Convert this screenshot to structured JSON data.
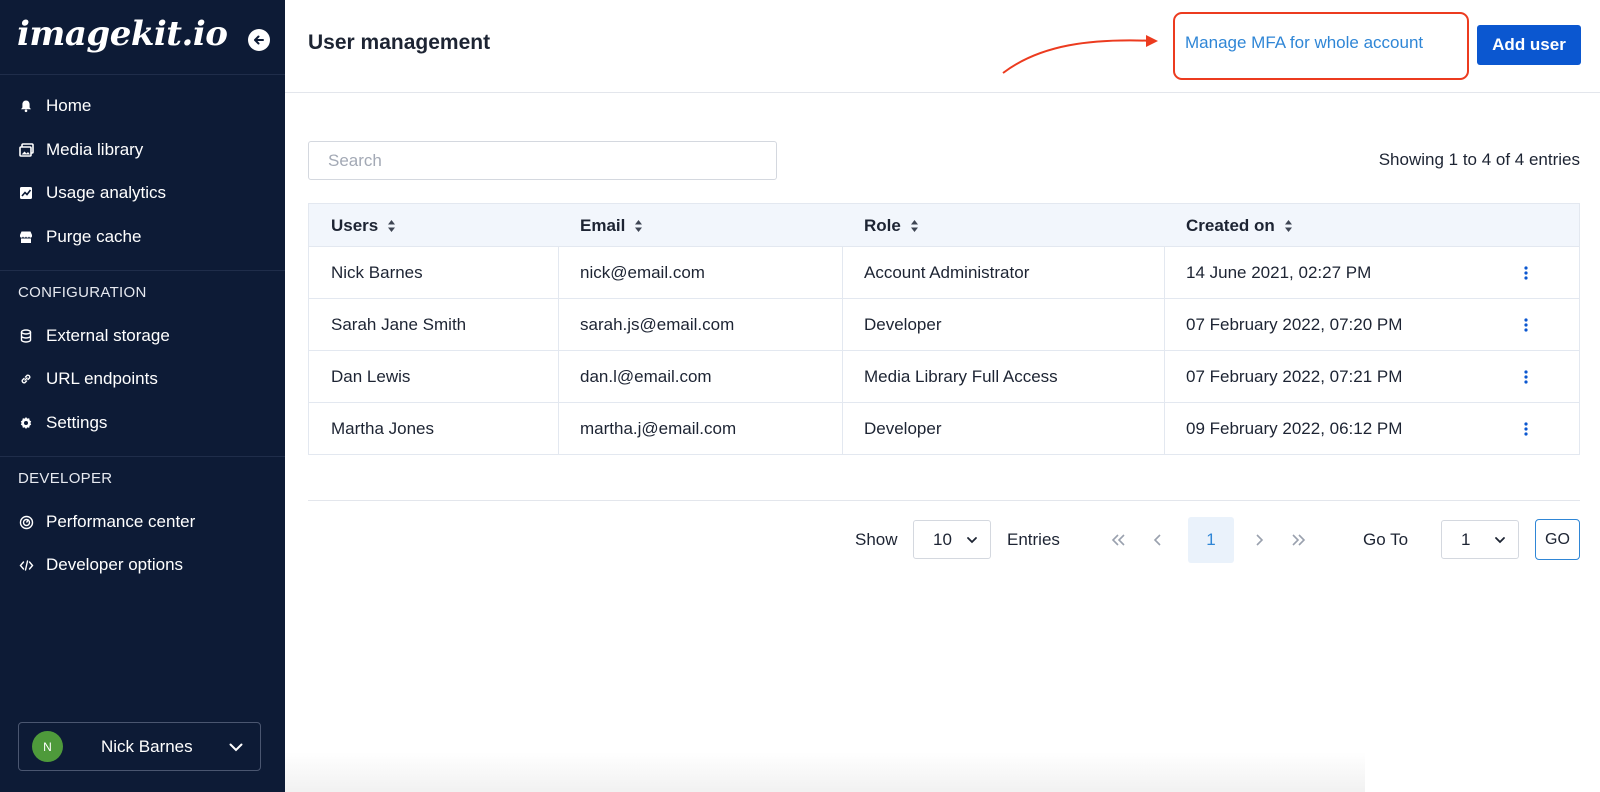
{
  "sidebar": {
    "logo": "imagekit.io",
    "nav_primary": [
      {
        "label": "Home",
        "icon": "bell-icon"
      },
      {
        "label": "Media library",
        "icon": "image-gallery-icon"
      },
      {
        "label": "Usage analytics",
        "icon": "chart-icon"
      },
      {
        "label": "Purge cache",
        "icon": "store-icon"
      }
    ],
    "configuration_label": "CONFIGURATION",
    "nav_configuration": [
      {
        "label": "External storage",
        "icon": "database-icon"
      },
      {
        "label": "URL endpoints",
        "icon": "link-icon"
      },
      {
        "label": "Settings",
        "icon": "gear-icon"
      }
    ],
    "developer_label": "DEVELOPER",
    "nav_developer": [
      {
        "label": "Performance center",
        "icon": "gauge-icon"
      },
      {
        "label": "Developer options",
        "icon": "code-icon"
      }
    ],
    "user": {
      "initial": "N",
      "name": "Nick Barnes",
      "avatar_color": "#4e9a3b"
    }
  },
  "header": {
    "title": "User management",
    "mfa_link": "Manage MFA for whole account",
    "add_user": "Add user",
    "annotation_color": "#ec3b1f"
  },
  "search": {
    "placeholder": "Search",
    "value": ""
  },
  "showing_text": "Showing 1 to 4 of 4 entries",
  "table": {
    "columns": [
      "Users",
      "Email",
      "Role",
      "Created on"
    ],
    "rows": [
      {
        "user": "Nick Barnes",
        "email": "nick@email.com",
        "role": "Account Administrator",
        "created": "14 June 2021, 02:27 PM"
      },
      {
        "user": "Sarah Jane Smith",
        "email": "sarah.js@email.com",
        "role": "Developer",
        "created": "07 February 2022, 07:20 PM"
      },
      {
        "user": "Dan Lewis",
        "email": "dan.l@email.com",
        "role": "Media Library Full Access",
        "created": "07 February 2022, 07:21 PM"
      },
      {
        "user": "Martha Jones",
        "email": "martha.j@email.com",
        "role": "Developer",
        "created": "09 February 2022, 06:12 PM"
      }
    ]
  },
  "pagination": {
    "show_label": "Show",
    "page_size": "10",
    "entries_label": "Entries",
    "current_page": "1",
    "goto_label": "Go To",
    "goto_value": "1",
    "go_button": "GO"
  },
  "colors": {
    "sidebar_bg": "#0d1b36",
    "accent": "#0b57d0",
    "link": "#2f86d6"
  }
}
